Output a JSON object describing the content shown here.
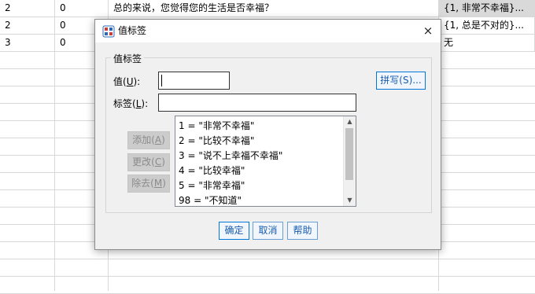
{
  "spreadsheet": {
    "rows": [
      {
        "c1": "2",
        "c2": "0",
        "c3": "总的来说，您觉得您的生活是否幸福？",
        "c4": "{1, 非常不幸福}..."
      },
      {
        "c1": "2",
        "c2": "0",
        "c3": "",
        "c4": "{1, 总是不对的}..."
      },
      {
        "c1": "3",
        "c2": "0",
        "c3": "",
        "c4": "无"
      }
    ]
  },
  "dialog": {
    "title": "值标签",
    "close_icon": "×",
    "group_label": "值标签",
    "value_label": "值",
    "value_mnemonic": "U",
    "value_suffix": "):",
    "label_label": "标签",
    "label_mnemonic": "L",
    "label_suffix": "):",
    "value_input": "",
    "label_input": "",
    "spell_button": "拼写(S)...",
    "add_button": "添加",
    "add_mnemonic": "A",
    "change_button": "更改",
    "change_mnemonic": "C",
    "remove_button": "除去",
    "remove_mnemonic": "M",
    "list_items": [
      "1 = \"非常不幸福\"",
      "2 = \"比较不幸福\"",
      "3 = \"说不上幸福不幸福\"",
      "4 = \"比较幸福\"",
      "5 = \"非常幸福\"",
      "98 = \"不知道\""
    ],
    "ok_button": "确定",
    "cancel_button": "取消",
    "help_button": "帮助"
  }
}
